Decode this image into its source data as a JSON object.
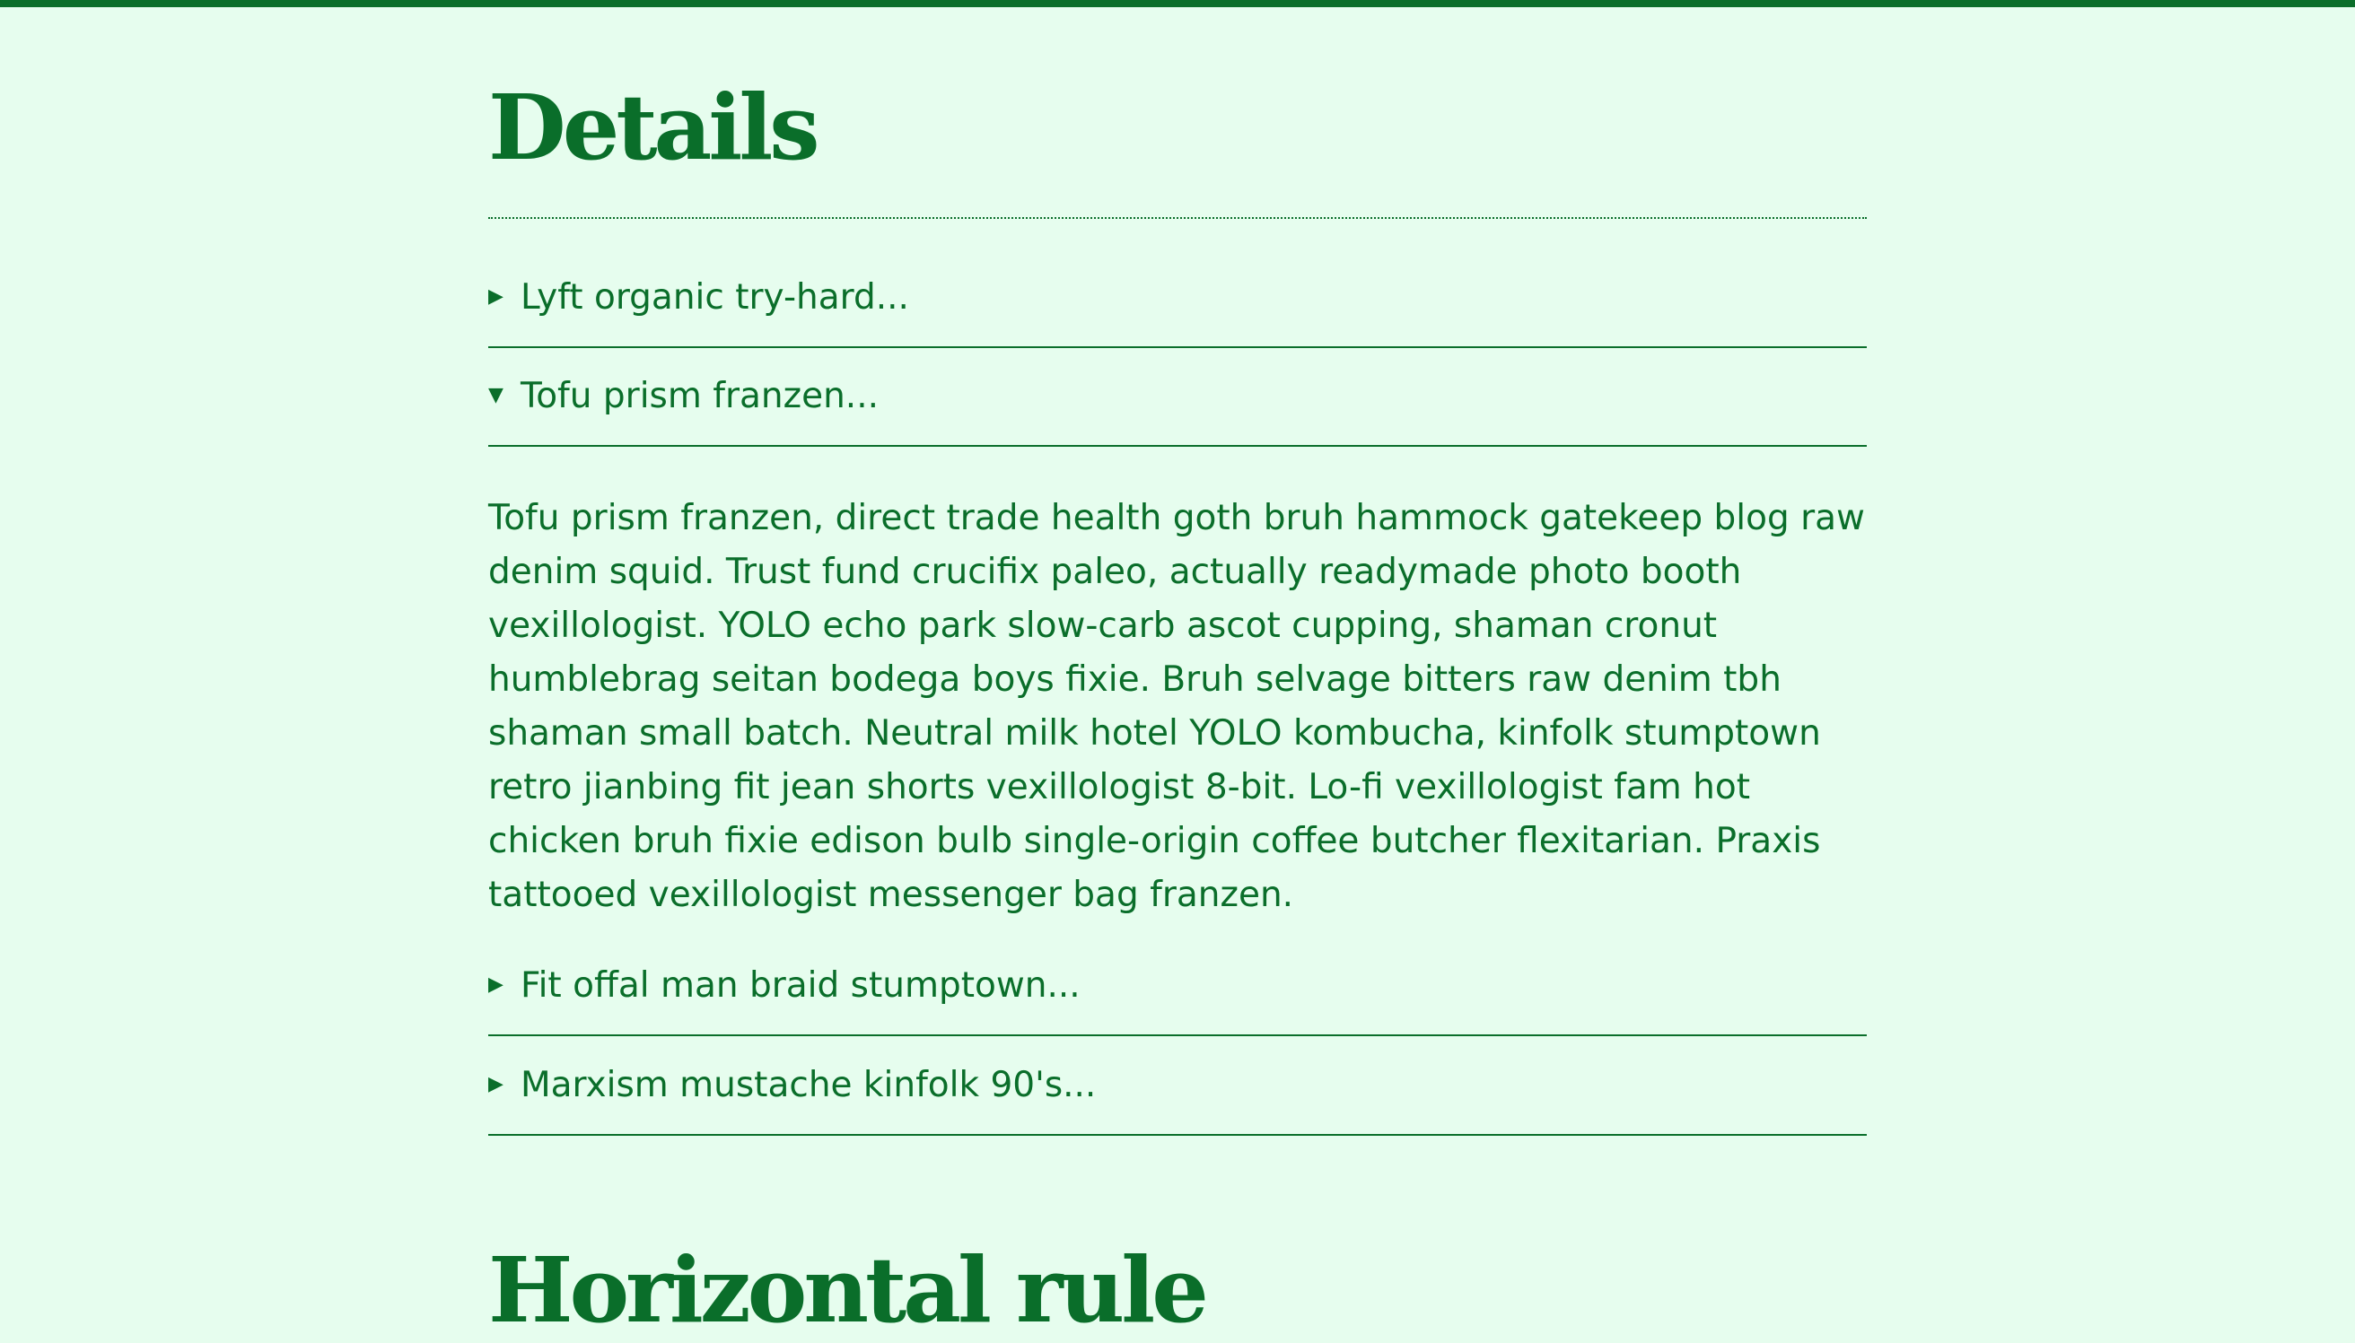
{
  "theme": {
    "background": "#e6fdee",
    "accent": "#0a6e2a"
  },
  "details_section": {
    "title": "Details",
    "items": [
      {
        "summary": "Lyft organic try-hard...",
        "open": false,
        "marker_icon": "triangle-right-icon",
        "marker": "▶"
      },
      {
        "summary": "Tofu prism franzen...",
        "open": true,
        "marker_icon": "triangle-down-icon",
        "marker": "▼",
        "body": "Tofu prism franzen, direct trade health goth bruh hammock gatekeep blog raw denim squid. Trust fund crucifix paleo, actually readymade photo booth vexillologist. YOLO echo park slow-carb ascot cupping, shaman cronut humblebrag seitan bodega boys fixie. Bruh selvage bitters raw denim tbh shaman small batch. Neutral milk hotel YOLO kombucha, kinfolk stumptown retro jianbing fit jean shorts vexillologist 8-bit. Lo-fi vexillologist fam hot chicken bruh fixie edison bulb single-origin coffee butcher flexitarian. Praxis tattooed vexillologist messenger bag franzen."
      },
      {
        "summary": "Fit offal man braid stumptown...",
        "open": false,
        "marker_icon": "triangle-right-icon",
        "marker": "▶"
      },
      {
        "summary": "Marxism mustache kinfolk 90's...",
        "open": false,
        "marker_icon": "triangle-right-icon",
        "marker": "▶"
      }
    ]
  },
  "next_section": {
    "title": "Horizontal rule"
  }
}
